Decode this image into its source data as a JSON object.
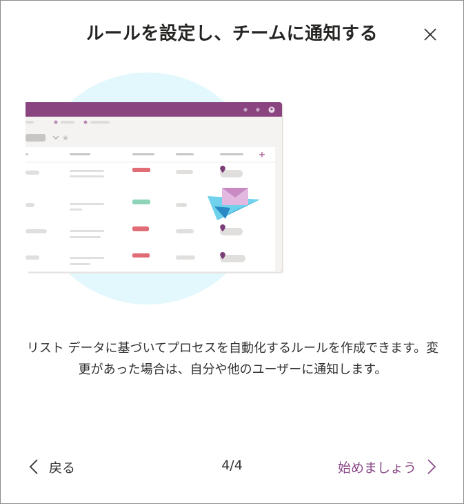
{
  "dialog": {
    "title": "ルールを設定し、チームに通知する",
    "close_icon": "close-icon",
    "description": "リスト データに基づいてプロセスを自動化するルールを作成できます。変更があった場合は、自分や他のユーザーに通知します。",
    "back_label": "戻る",
    "back_icon": "chevron-left-icon",
    "page_indicator": "4/4",
    "start_label": "始めましょう",
    "start_icon": "chevron-right-icon"
  },
  "colors": {
    "accent": "#8b4a8a",
    "header_bar": "#8a4580",
    "circle_bg": "#e3f8fc",
    "status_red": "#e06c75",
    "status_green": "#8fd3b9",
    "plane_blue": "#5cc6e8",
    "envelope_pink": "#d8a6d8"
  }
}
